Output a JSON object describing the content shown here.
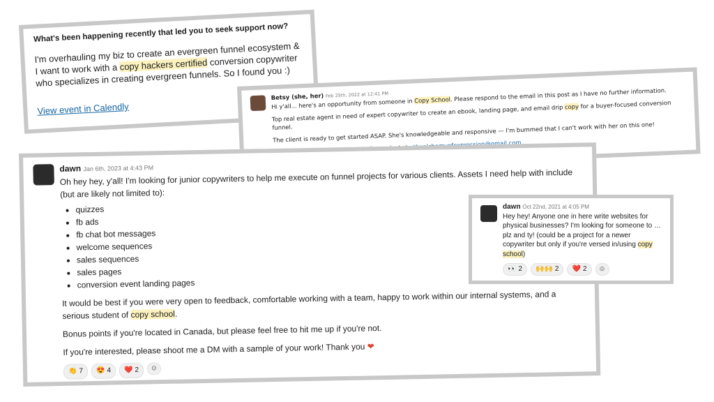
{
  "calendly": {
    "question": "What's been happening recently that led you to seek support now?",
    "answer_pre": "I'm overhauling my biz to create an evergreen funnel ecosystem & I want to work with a ",
    "answer_hl": "copy hackers certified",
    "answer_post": " conversion copywriter who specializes in creating evergreen funnels. So I found you :)",
    "link": "View event in Calendly"
  },
  "betsy": {
    "name": "Betsy (she, her)",
    "timestamp": "Feb 25th, 2022 at 12:41 PM",
    "line1_pre": "Hi y'all... here's an opportunity from someone in ",
    "line1_hl": "Copy School",
    "line1_post": ". Please respond to the email in this post as I have no further information.",
    "line2_pre": "Top real estate agent in need of expert copywriter to create an ebook, landing page, and email drip ",
    "line2_hl": "copy",
    "line2_post": " for a buyer-focused conversion funnel.",
    "line3": "The client is ready to get started ASAP. She's knowledgeable and responsive — I'm bummed that I can't work with her on this one!",
    "line4_pre": "Please send your portfolio or similar projects to ",
    "email": "thealchemyofexpression@gmail.com",
    "line4_post": "."
  },
  "dawn_main": {
    "name": "dawn",
    "timestamp": "Jan 6th, 2023 at 4:43 PM",
    "intro": "Oh hey hey, y'all! I'm looking for junior copywriters to help me execute on funnel projects for various clients. Assets I need help with include (but are likely not limited to):",
    "items": [
      "quizzes",
      "fb ads",
      "fb chat bot messages",
      "welcome sequences",
      "sales sequences",
      "sales pages",
      "conversion event landing pages"
    ],
    "para1_pre": "It would be best if you were very open to feedback, comfortable working with a team, happy to work within our internal systems, and a serious student of ",
    "para1_hl": "copy school",
    "para1_post": ".",
    "para2": "Bonus points if you're located in Canada, but please feel free to hit me up if you're not.",
    "para3": "If you're interested, please shoot me a DM with a sample of your work! Thank you",
    "reactions": [
      {
        "icon": "👏",
        "count": "7"
      },
      {
        "icon": "😍",
        "count": "4"
      },
      {
        "icon": "❤️",
        "count": "2"
      }
    ]
  },
  "dawn_small": {
    "name": "dawn",
    "timestamp": "Oct 22nd, 2021 at 4:05 PM",
    "text_pre": "Hey hey! Anyone one in here write websites for physical businesses? I'm looking for someone to … plz and ty! (could be a project for a newer copywriter but only if you're versed in/using ",
    "text_hl": "copy school",
    "text_post": ")",
    "reactions": [
      {
        "icon": "👀",
        "count": "2"
      },
      {
        "icon": "🙌🙌",
        "count": "2"
      },
      {
        "icon": "❤️",
        "count": "2"
      }
    ]
  },
  "colors": {
    "highlight": "#fcf2bf",
    "link": "#1264a3",
    "border": "#c8c8c8"
  }
}
